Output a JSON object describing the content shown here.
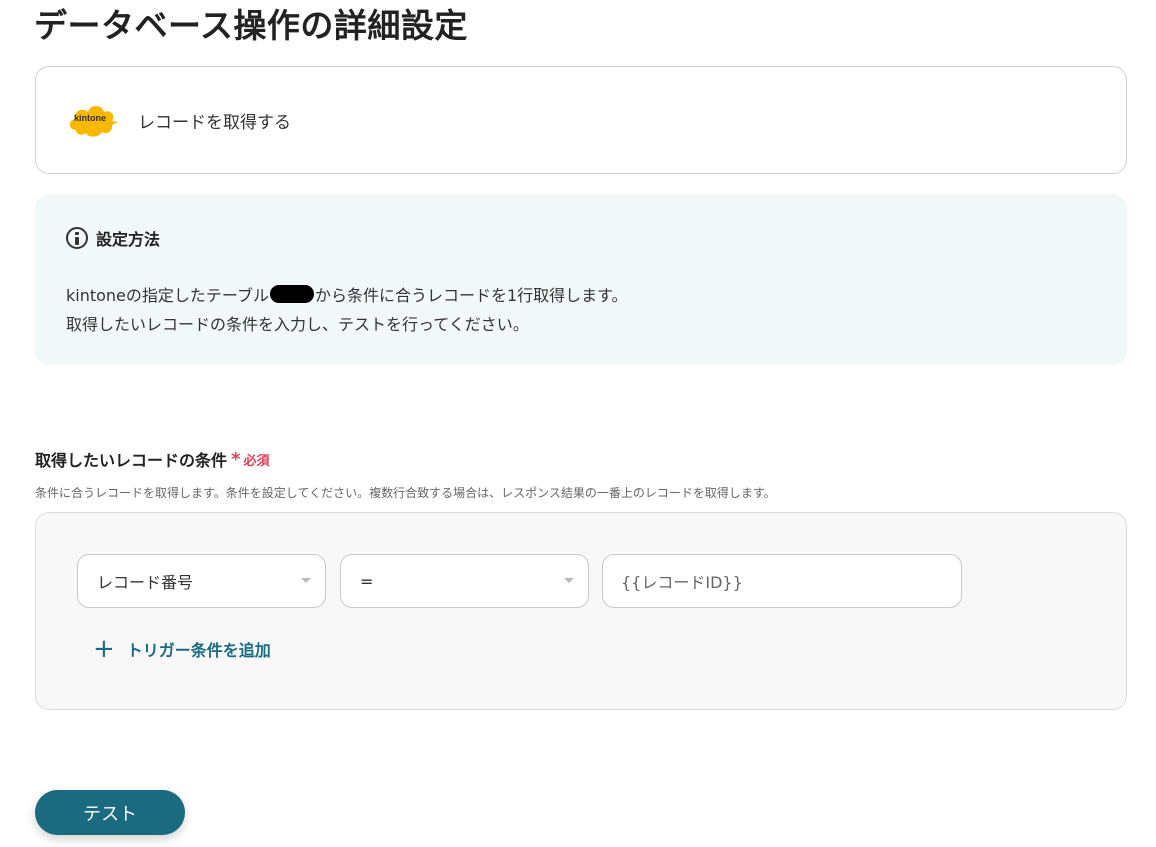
{
  "page": {
    "title": "データベース操作の詳細設定"
  },
  "app": {
    "logo_text": "kintone",
    "logo_color": "#f8b800",
    "action": "レコードを取得する"
  },
  "info": {
    "icon": "info-circle-icon",
    "title": "設定方法",
    "line1_before": "kintoneの指定したテーブル",
    "line1_after": "から条件に合うレコードを1行取得します。",
    "line2": "取得したいレコードの条件を入力し、テストを行ってください。"
  },
  "condition": {
    "label": "取得したいレコードの条件",
    "required_star": "*",
    "required_text": "必須",
    "help": "条件に合うレコードを取得します。条件を設定してください。複数行合致する場合は、レスポンス結果の一番上のレコードを取得します。",
    "field_select": "レコード番号",
    "operator_select": "=",
    "value": "{{レコードID}}",
    "add_icon": "+",
    "add_label": "トリガー条件を追加"
  },
  "actions": {
    "test_label": "テスト"
  },
  "colors": {
    "accent": "#1a6b80",
    "required": "#e0425a",
    "info_bg": "#f0f9f7"
  }
}
